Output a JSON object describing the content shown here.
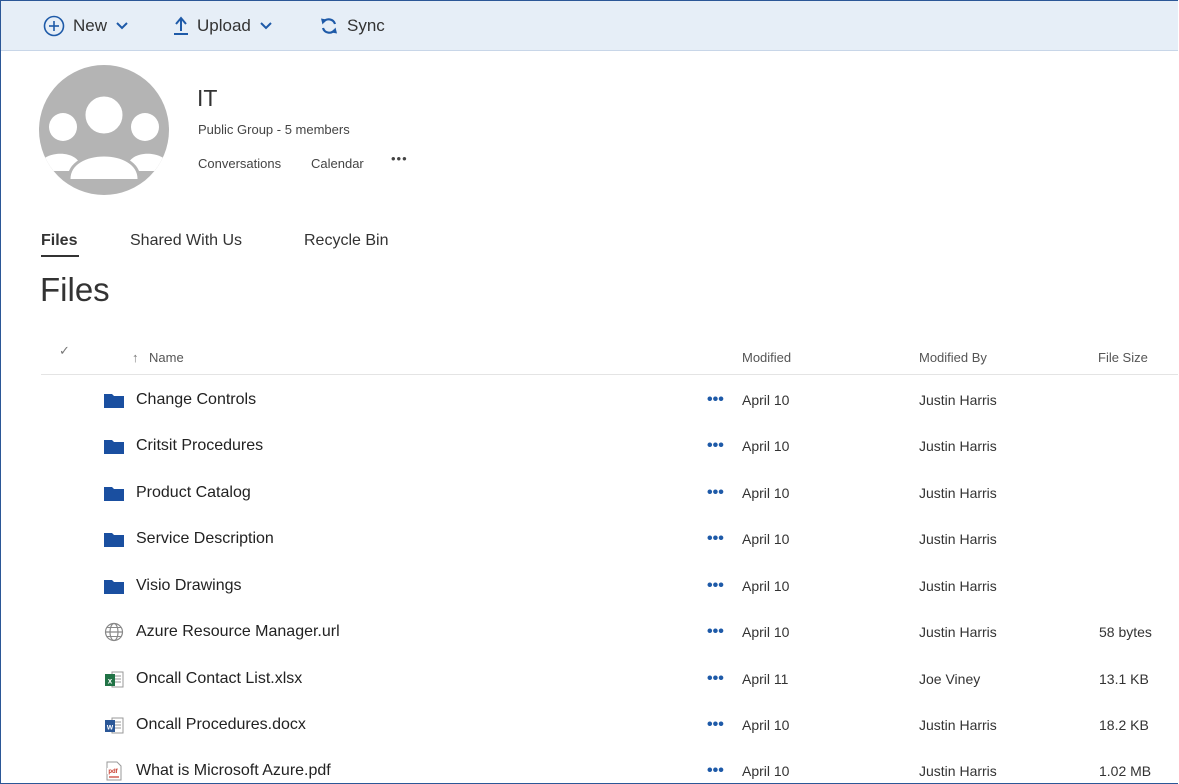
{
  "toolbar": {
    "new_label": "New",
    "upload_label": "Upload",
    "sync_label": "Sync"
  },
  "group": {
    "name": "IT",
    "subtitle": "Public Group - 5 members",
    "links": [
      "Conversations",
      "Calendar"
    ],
    "more": "•••"
  },
  "tabs": [
    {
      "label": "Files",
      "active": true
    },
    {
      "label": "Shared With Us",
      "active": false
    },
    {
      "label": "Recycle Bin",
      "active": false
    }
  ],
  "page_title": "Files",
  "columns": {
    "select": "✓",
    "sort_indicator": "↑",
    "name": "Name",
    "modified": "Modified",
    "modified_by": "Modified By",
    "file_size": "File Size"
  },
  "row_more": "•••",
  "files": [
    {
      "name": "Change Controls",
      "type": "folder-icon",
      "modified": "April 10",
      "modified_by": "Justin Harris",
      "size": ""
    },
    {
      "name": "Critsit Procedures",
      "type": "folder-icon",
      "modified": "April 10",
      "modified_by": "Justin Harris",
      "size": ""
    },
    {
      "name": "Product Catalog",
      "type": "folder-icon",
      "modified": "April 10",
      "modified_by": "Justin Harris",
      "size": ""
    },
    {
      "name": "Service Description",
      "type": "folder-icon",
      "modified": "April 10",
      "modified_by": "Justin Harris",
      "size": ""
    },
    {
      "name": "Visio Drawings",
      "type": "folder-icon",
      "modified": "April 10",
      "modified_by": "Justin Harris",
      "size": ""
    },
    {
      "name": "Azure Resource Manager.url",
      "type": "globe-icon",
      "modified": "April 10",
      "modified_by": "Justin Harris",
      "size": "58 bytes"
    },
    {
      "name": "Oncall Contact List.xlsx",
      "type": "excel-icon",
      "modified": "April 11",
      "modified_by": "Joe Viney",
      "size": "13.1 KB"
    },
    {
      "name": "Oncall Procedures.docx",
      "type": "word-icon",
      "modified": "April 10",
      "modified_by": "Justin Harris",
      "size": "18.2 KB"
    },
    {
      "name": "What is Microsoft Azure.pdf",
      "type": "pdf-icon",
      "modified": "April 10",
      "modified_by": "Justin Harris",
      "size": "1.02 MB"
    }
  ],
  "colors": {
    "accent": "#1e5aa8",
    "folder": "#1a4fa0",
    "toolbar_bg": "#e6eef7",
    "excel": "#217346",
    "word": "#2b5797",
    "pdf": "#c7392b"
  }
}
